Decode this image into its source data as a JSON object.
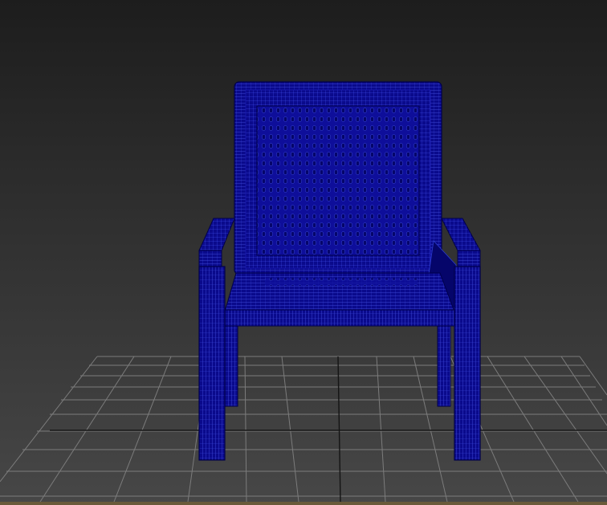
{
  "viewport": {
    "view": "front",
    "display_mode": "wireframe-on-shaded",
    "background_top": "#1d1d1d",
    "background_bottom": "#474747"
  },
  "object": {
    "type": "chair",
    "parts": [
      "backrest",
      "backrest-mesh",
      "armrest-left",
      "armrest-right",
      "seat",
      "front-leg-left",
      "front-leg-right",
      "back-leg-left",
      "back-leg-right"
    ],
    "color": "#0a0a8c",
    "wire_color": "#4a5aff"
  },
  "grid": {
    "color": "#8a8a8a",
    "axis_color": "#111111",
    "visible": true
  },
  "status_bar": {
    "color": "#6a5a3a"
  }
}
